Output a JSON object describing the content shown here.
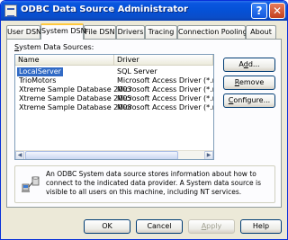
{
  "window": {
    "title": "ODBC Data Source Administrator",
    "help_glyph": "?",
    "close_glyph": "✕"
  },
  "tabs": [
    {
      "label": "User DSN"
    },
    {
      "label": "System DSN",
      "active": true
    },
    {
      "label": "File DSN"
    },
    {
      "label": "Drivers"
    },
    {
      "label": "Tracing"
    },
    {
      "label": "Connection Pooling"
    },
    {
      "label": "About"
    }
  ],
  "panel": {
    "group_label": "System Data Sources:",
    "group_label_hotkey": "S",
    "group_label_rest": "ystem Data Sources:",
    "columns": {
      "name": "Name",
      "driver": "Driver"
    },
    "rows": [
      {
        "name": "LocalServer",
        "driver": "SQL Server",
        "selected": true
      },
      {
        "name": "TrioMotors",
        "driver": "Microsoft Access Driver (*.mdb"
      },
      {
        "name": "Xtreme Sample Database 2003",
        "driver": "Microsoft Access Driver (*.mdb"
      },
      {
        "name": "Xtreme Sample Database 2005",
        "driver": "Microsoft Access Driver (*.mdb"
      },
      {
        "name": "Xtreme Sample Database 2008",
        "driver": "Microsoft Access Driver (*.mdb"
      }
    ],
    "buttons": {
      "add": {
        "hotkey": "d",
        "pre": "A",
        "post": "d..."
      },
      "remove": {
        "hotkey": "R",
        "pre": "",
        "post": "emove"
      },
      "configure": {
        "hotkey": "C",
        "pre": "",
        "post": "onfigure..."
      }
    },
    "info_text": "An ODBC System data source stores information about how to connect to the indicated data provider.  A System data source is visible to all users on this machine, including NT services."
  },
  "footer": {
    "ok": "OK",
    "cancel": "Cancel",
    "apply": {
      "pre": "",
      "hotkey": "A",
      "post": "pply"
    },
    "help": "Help"
  }
}
